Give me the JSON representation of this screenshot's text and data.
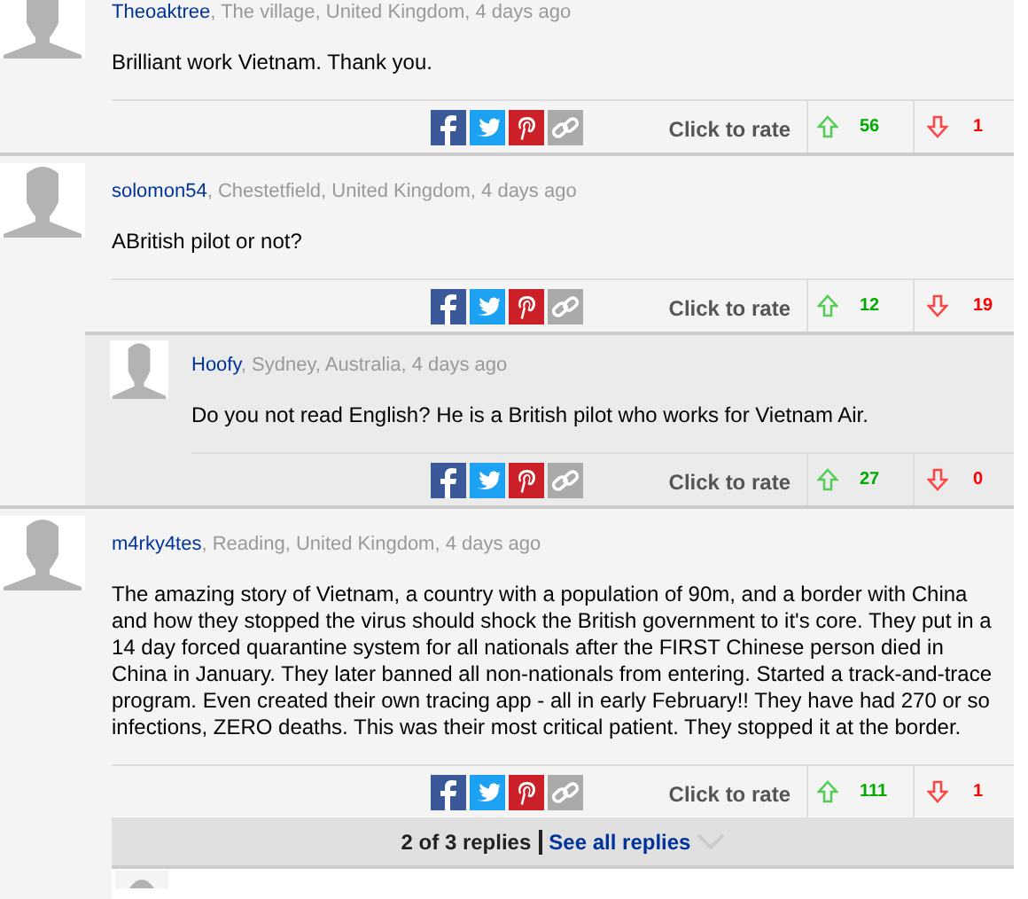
{
  "comments": [
    {
      "author": "Theoaktree",
      "meta": ", The village, United Kingdom, 4 days ago",
      "body": "Brilliant work Vietnam. Thank you.",
      "rate_label": "Click to rate",
      "up": "56",
      "down": "1"
    },
    {
      "author": "solomon54",
      "meta": ", Chestetfield, United Kingdom, 4 days ago",
      "body": "ABritish pilot or not?",
      "rate_label": "Click to rate",
      "up": "12",
      "down": "19",
      "replies": [
        {
          "author": "Hoofy",
          "meta": ", Sydney, Australia, 4 days ago",
          "body": "Do you not read English? He is a British pilot who works for Vietnam Air.",
          "rate_label": "Click to rate",
          "up": "27",
          "down": "0"
        }
      ]
    },
    {
      "author": "m4rky4tes",
      "meta": ", Reading, United Kingdom, 4 days ago",
      "body": "The amazing story of Vietnam, a country with a population of 90m, and a border with China and how they stopped the virus should shock the British government to it's core. They put in a 14 day forced quarantine system for all nationals after the FIRST Chinese person died in China in January. They later banned all non-nationals from entering. Started a track-and-trace program. Even created their own tracing app - all in early February!! They have had 270 or so infections, ZERO deaths. This was their most critical patient. They stopped it at the border.",
      "rate_label": "Click to rate",
      "up": "111",
      "down": "1",
      "replies_bar": {
        "count": "2 of 3 replies",
        "link": "See all replies"
      }
    }
  ]
}
